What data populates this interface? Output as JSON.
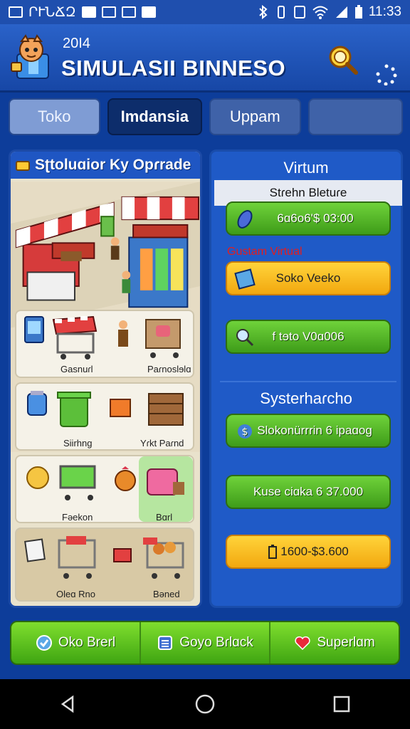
{
  "status_bar": {
    "carrier": "ՐՒՆՃԶ",
    "time": "11:33"
  },
  "header": {
    "year": "20Ӏ4",
    "title": "SIMULASII BINNESO"
  },
  "tabs": [
    {
      "label": "Toko"
    },
    {
      "label": "Imdansia"
    },
    {
      "label": "Uppam"
    },
    {
      "label": ""
    }
  ],
  "left_panel": {
    "title": "Sʈtoluɑior Ky Opɾrade",
    "cards": [
      {
        "label_a": "Gasnuɾl",
        "label_b": "Paɾnoslɘlɑ"
      },
      {
        "label_a": "Siirhng",
        "label_b": "Yɾkt Paɾnd"
      },
      {
        "label_a": "Fəekon",
        "label_b": "Bɑrl"
      },
      {
        "label_a": "Oleɑ Rno",
        "label_b": "Bəned"
      }
    ]
  },
  "right_panel": {
    "title": "Virtum",
    "subtitle": "Stɾehn Bletuɾe",
    "custom_label": "Gustam Virtual",
    "buttons": [
      {
        "label": "6ɑ6o6'$ 03:00"
      },
      {
        "label": "Soko Veeko"
      },
      {
        "label": "f tɘto V0ɑ006"
      }
    ],
    "section_title": "Systerhaɾcho",
    "section_buttons": [
      {
        "label": "Slokonürrrin 6 ipaɑog"
      },
      {
        "label": "Kuse ciɑka 6 37.000"
      },
      {
        "label": "1600-$3.600"
      }
    ]
  },
  "bottom_bar": [
    {
      "label": "Oko Brerl"
    },
    {
      "label": "Goyo Bɾlɑck"
    },
    {
      "label": "Superlɑm"
    }
  ],
  "colors": {
    "header_blue": "#2a62c9",
    "panel_blue": "#1f5ac7",
    "btn_green": "#4db024",
    "btn_yellow": "#f5b820",
    "custom_red": "#e41d1d"
  }
}
